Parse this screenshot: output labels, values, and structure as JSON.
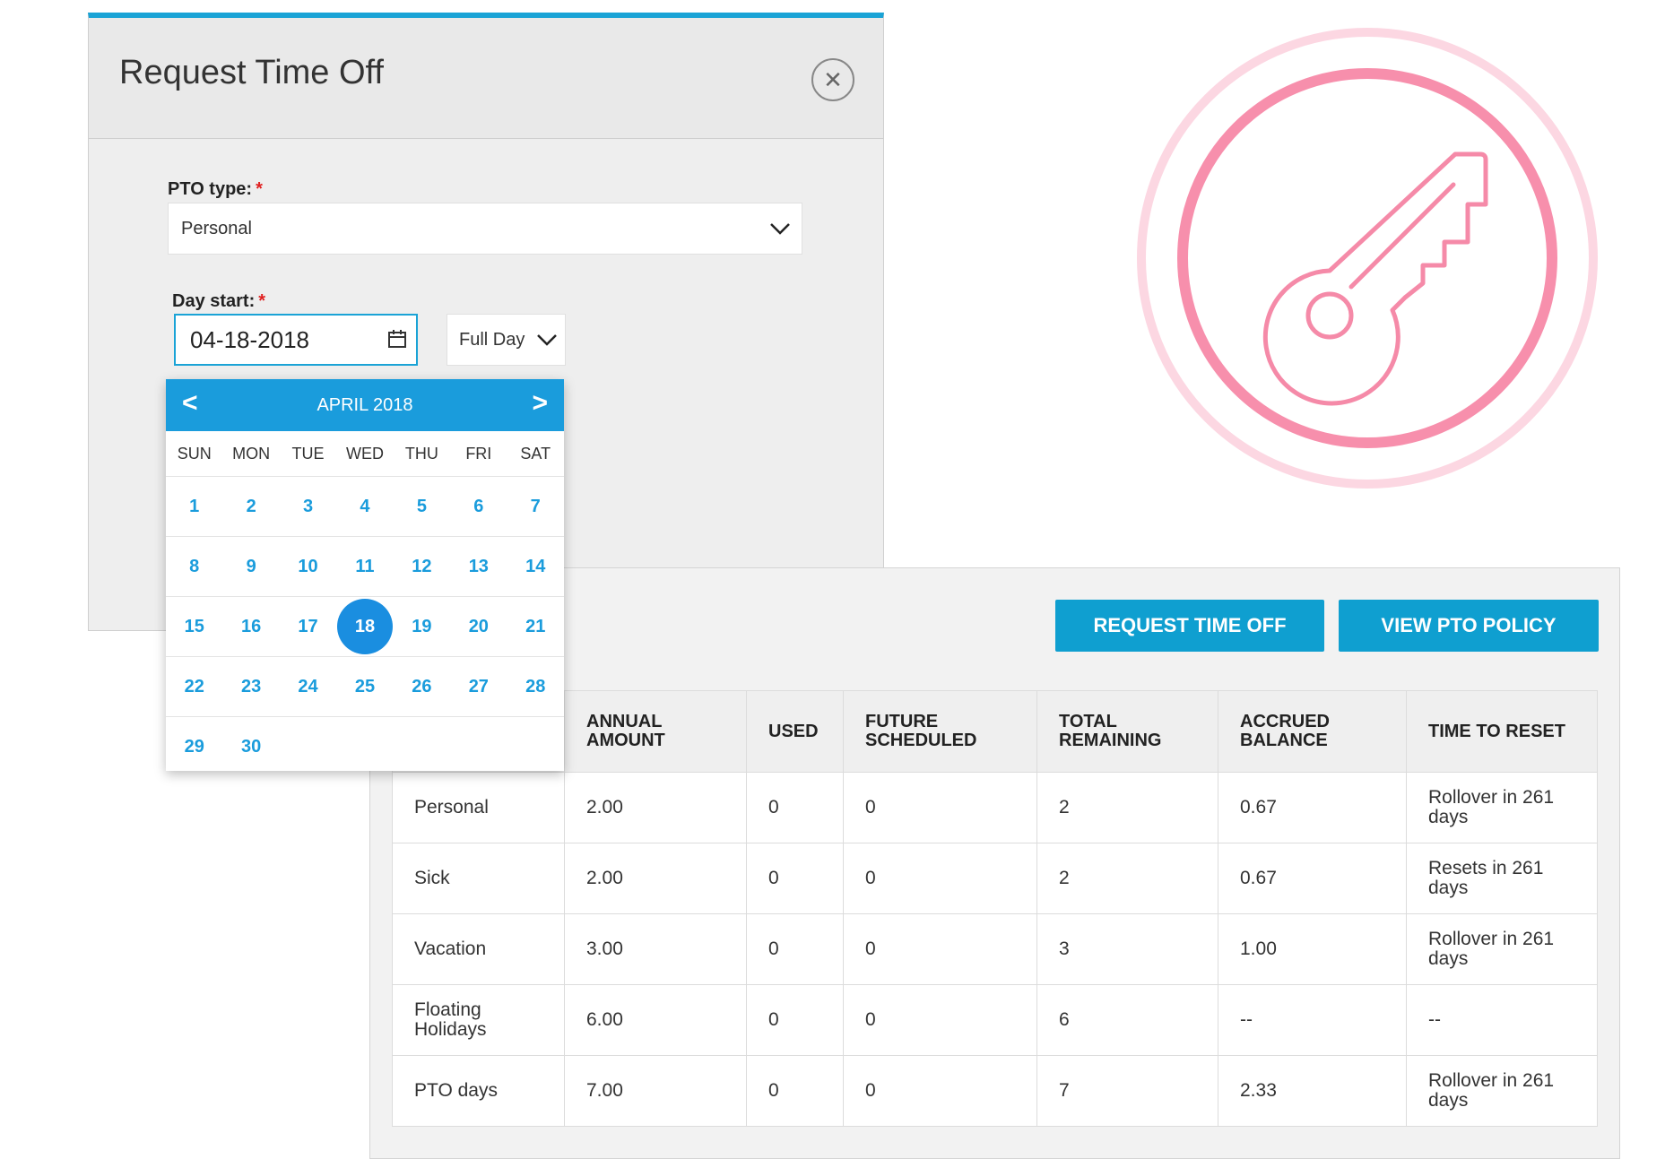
{
  "modal": {
    "title": "Request Time Off",
    "close_icon": "close-icon",
    "pto_type_label": "PTO type:",
    "required_mark": "*",
    "pto_type_value": "Personal",
    "day_start_label": "Day start:",
    "date_value": "04-18-2018",
    "duration_value": "Full Day"
  },
  "calendar": {
    "month_label": "APRIL 2018",
    "prev": "<",
    "next": ">",
    "weekdays": [
      "SUN",
      "MON",
      "TUE",
      "WED",
      "THU",
      "FRI",
      "SAT"
    ],
    "weeks": [
      [
        "1",
        "2",
        "3",
        "4",
        "5",
        "6",
        "7"
      ],
      [
        "8",
        "9",
        "10",
        "11",
        "12",
        "13",
        "14"
      ],
      [
        "15",
        "16",
        "17",
        "18",
        "19",
        "20",
        "21"
      ],
      [
        "22",
        "23",
        "24",
        "25",
        "26",
        "27",
        "28"
      ],
      [
        "29",
        "30",
        "",
        "",
        "",
        "",
        ""
      ]
    ],
    "selected_day": "18"
  },
  "actions": {
    "request_time_off": "REQUEST TIME OFF",
    "view_pto_policy": "VIEW PTO POLICY"
  },
  "table": {
    "headers": [
      "",
      "ANNUAL AMOUNT",
      "USED",
      "FUTURE SCHEDULED",
      "TOTAL REMAINING",
      "ACCRUED BALANCE",
      "TIME TO RESET"
    ],
    "rows": [
      [
        "Personal",
        "2.00",
        "0",
        "0",
        "2",
        "0.67",
        "Rollover in 261 days"
      ],
      [
        "Sick",
        "2.00",
        "0",
        "0",
        "2",
        "0.67",
        "Resets in 261 days"
      ],
      [
        "Vacation",
        "3.00",
        "0",
        "0",
        "3",
        "1.00",
        "Rollover in 261 days"
      ],
      [
        "Floating Holidays",
        "6.00",
        "0",
        "0",
        "6",
        "--",
        "--"
      ],
      [
        "PTO days",
        "7.00",
        "0",
        "0",
        "7",
        "2.33",
        "Rollover in 261 days"
      ]
    ]
  },
  "colors": {
    "accent": "#1aa3d6",
    "calendar_header": "#1a9cdc",
    "selected_day": "#1a8ee0",
    "button": "#0f9fd0",
    "badge_inner": "#f78fac",
    "badge_outer": "#fcd7e2"
  },
  "badge_icon": "key-icon"
}
